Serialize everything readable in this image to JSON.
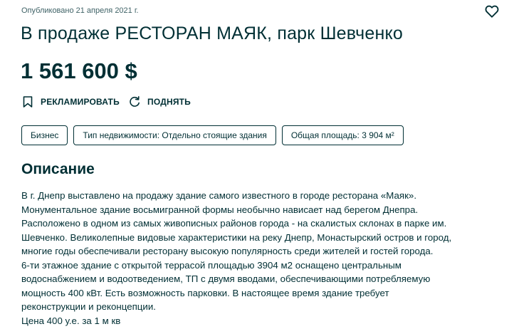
{
  "published": "Опубликовано 21 апреля 2021 г.",
  "favorite_icon": "heart-outline-icon",
  "title": "В продаже РЕСТОРАН МАЯК, парк Шевченко",
  "price": "1 561 600 $",
  "actions": {
    "promote": {
      "label": "РЕКЛАМИРОВАТЬ",
      "icon": "bookmark-icon"
    },
    "raise": {
      "label": "ПОДНЯТЬ",
      "icon": "refresh-icon"
    }
  },
  "tags": [
    "Бизнес",
    "Тип недвижимости: Отдельно стоящие здания",
    "Общая площадь: 3 904 м²"
  ],
  "description": {
    "heading": "Описание",
    "lines": [
      "В г. Днепр выставлено на продажу здание самого известного в городе ресторана «Маяк».",
      "Монументальное здание восьмигранной формы необычно нависает над берегом Днепра.",
      "Расположено в одном из самых живописных районов города - на скалистых склонах в парке им.",
      "Шевченко. Великолепные видовые характеристики на реку Днепр, Монастырский остров и город,",
      "многие годы обеспечивали ресторану высокую популярность среди жителей и гостей города.",
      "6-ти этажное здание с открытой террасой площадью 3904 м2 оснащено центральным",
      "водоснабжением и водоотведением, ТП с двумя вводами, обеспечивающими потребляемую",
      "мощность 400 кВт. Есть возможность парковки. В настоящее время здание требует",
      "реконструкции и реконцепции.",
      "Цена 400 у.е. за 1 м кв"
    ]
  },
  "colors": {
    "text": "#002f34",
    "muted": "#406367",
    "background": "#ffffff"
  }
}
